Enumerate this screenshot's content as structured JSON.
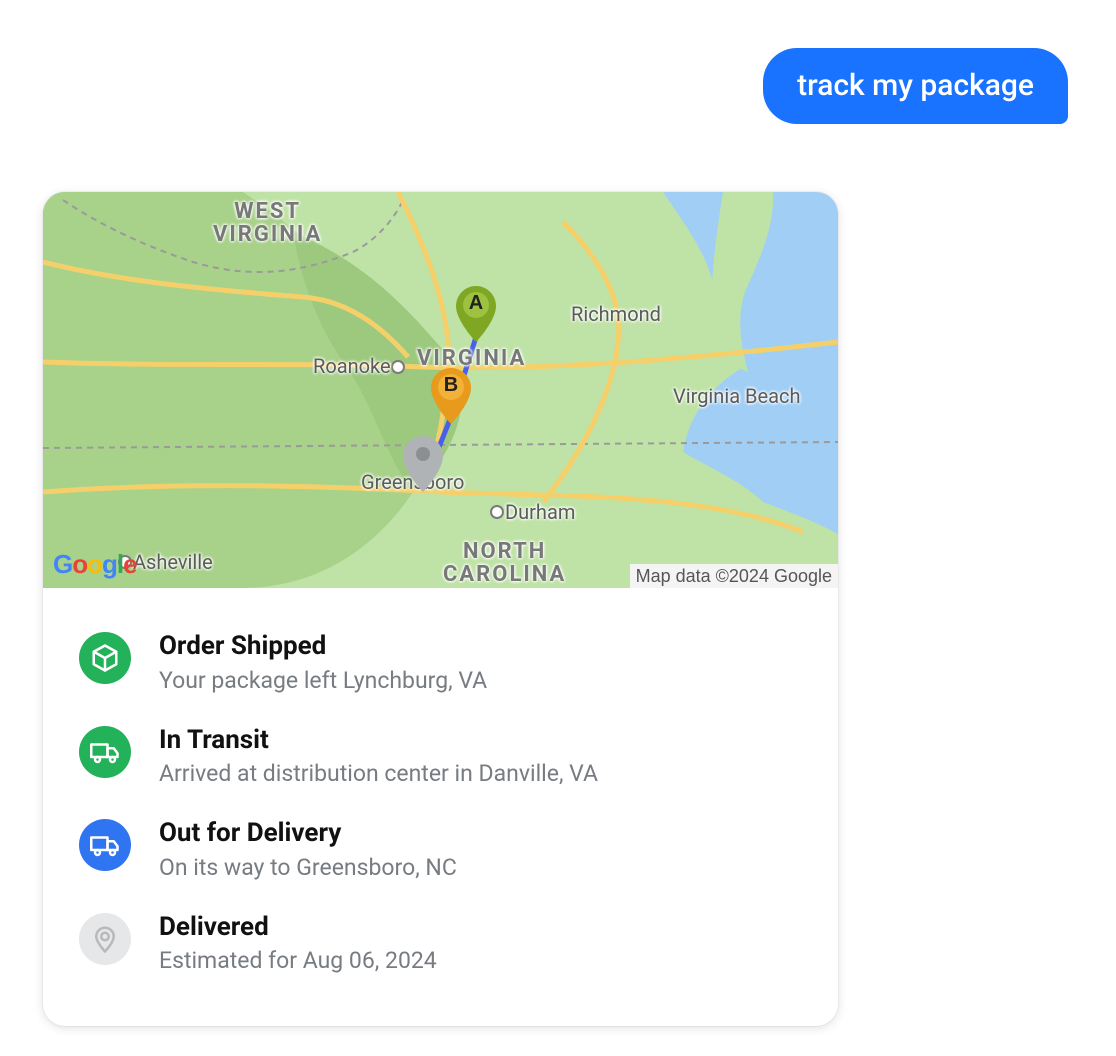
{
  "chat": {
    "user_message": "track my package"
  },
  "map": {
    "attribution": "Map data ©2024 Google",
    "google_logo_text": "Google",
    "state_labels": {
      "west_virginia_line1": "WEST",
      "west_virginia_line2": "VIRGINIA",
      "virginia": "VIRGINIA",
      "north_carolina_line1": "NORTH",
      "north_carolina_line2": "CAROLINA"
    },
    "city_labels": {
      "roanoke": "Roanoke",
      "richmond": "Richmond",
      "greensboro": "Greensboro",
      "durham": "Durham",
      "asheville": "Asheville",
      "virginia_beach": "Virginia Beach"
    },
    "markers": {
      "a_letter": "A",
      "b_letter": "B",
      "a_color": "#7fa723",
      "b_color": "#eaaайт14",
      "c_color": "#b0b3b6"
    }
  },
  "steps": [
    {
      "title": "Order Shipped",
      "subtitle": "Your package left Lynchburg, VA",
      "icon": "package-icon",
      "color": "green"
    },
    {
      "title": "In Transit",
      "subtitle": "Arrived at distribution center in Danville, VA",
      "icon": "truck-icon",
      "color": "green"
    },
    {
      "title": "Out for Delivery",
      "subtitle": "On its way to Greensboro, NC",
      "icon": "truck-icon",
      "color": "blue"
    },
    {
      "title": "Delivered",
      "subtitle": "Estimated for Aug 06, 2024",
      "icon": "location-pin-icon",
      "color": "gray"
    }
  ]
}
